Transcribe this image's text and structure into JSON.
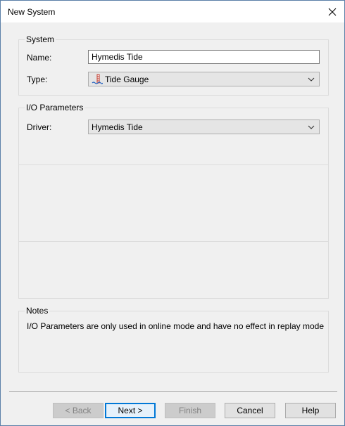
{
  "window": {
    "title": "New System"
  },
  "system_group": {
    "label": "System",
    "name_label": "Name:",
    "name_value": "Hymedis Tide",
    "type_label": "Type:",
    "type_value": "Tide Gauge",
    "type_icon": "tide-gauge-icon"
  },
  "io_group": {
    "label": "I/O Parameters",
    "driver_label": "Driver:",
    "driver_value": "Hymedis Tide"
  },
  "notes_group": {
    "label": "Notes",
    "text": "I/O Parameters are only used in online mode and have no effect in replay mode"
  },
  "buttons": {
    "back": "< Back",
    "next": "Next >",
    "finish": "Finish",
    "cancel": "Cancel",
    "help": "Help"
  },
  "colors": {
    "accent": "#0078d7",
    "window_bg": "#f0f0f0",
    "border": "#5a7fa8"
  }
}
